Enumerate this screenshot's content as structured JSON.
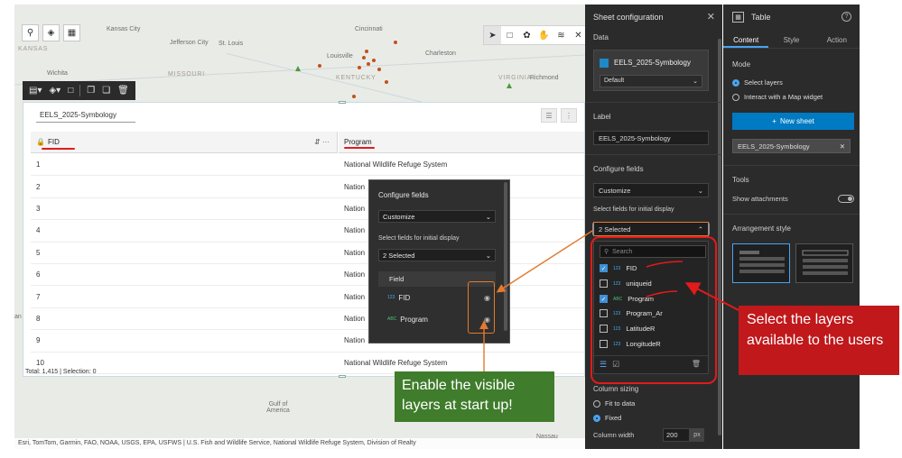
{
  "map": {
    "places": {
      "kansas_city": "Kansas City",
      "kansas": "KANSAS",
      "jefferson_city": "Jefferson City",
      "st_louis": "St. Louis",
      "missouri": "MISSOURI",
      "wichita": "Wichita",
      "cincinnati": "Cincinnati",
      "louisville": "Louisville",
      "kentucky": "KENTUCKY",
      "charleston": "Charleston",
      "virginia": "VIRGINIA",
      "richmond": "Richmond",
      "gulf_of_mexico": "Gulf of America",
      "nassau": "Nassau",
      "an": "an"
    },
    "attribution": "Esri, TomTom, Garmin, FAO, NOAA, USGS, EPA, USFWS | U.S. Fish and Wildlife Service, National Wildlife Refuge System, Division of Realty"
  },
  "table": {
    "tab_label": "EELS_2025-Symbology",
    "columns": {
      "fid": "FID",
      "program": "Program"
    },
    "rows": [
      {
        "fid": "1",
        "program": "National Wildlife Refuge System"
      },
      {
        "fid": "2",
        "program": "Nation"
      },
      {
        "fid": "3",
        "program": "Nation"
      },
      {
        "fid": "4",
        "program": "Nation"
      },
      {
        "fid": "5",
        "program": "Nation"
      },
      {
        "fid": "6",
        "program": "Nation"
      },
      {
        "fid": "7",
        "program": "Nation"
      },
      {
        "fid": "8",
        "program": "Nation"
      },
      {
        "fid": "9",
        "program": "Nation"
      },
      {
        "fid": "10",
        "program": "National Wildlife Refuge System"
      }
    ],
    "total": "Total: 1,415 | Selection: 0"
  },
  "popup": {
    "title": "Configure fields",
    "mode_value": "Customize",
    "select_label": "Select fields for initial display",
    "selected_value": "2 Selected",
    "field_header": "Field",
    "fields": [
      {
        "name": "FID",
        "type": "123"
      },
      {
        "name": "Program",
        "type": "ABC"
      }
    ]
  },
  "sheet_config": {
    "title": "Sheet configuration",
    "data_label": "Data",
    "datasource_name": "EELS_2025-Symbology",
    "view_value": "Default",
    "label_section": "Label",
    "label_value": "EELS_2025-Symbology",
    "configure_fields": "Configure fields",
    "mode_value": "Customize",
    "select_label": "Select fields for initial display",
    "selected_value": "2 Selected",
    "search_placeholder": "Search",
    "field_list": [
      {
        "name": "FID",
        "type": "123",
        "checked": true
      },
      {
        "name": "uniqueid",
        "type": "123",
        "checked": false
      },
      {
        "name": "Program",
        "type": "ABC",
        "checked": true
      },
      {
        "name": "Program_Ar",
        "type": "123",
        "checked": false
      },
      {
        "name": "LatitudeR",
        "type": "123",
        "checked": false
      },
      {
        "name": "LongitudeR",
        "type": "123",
        "checked": false
      }
    ],
    "column_sizing": "Column sizing",
    "fit_to_data": "Fit to data",
    "fixed": "Fixed",
    "column_width_label": "Column width",
    "column_width_value": "200",
    "column_width_unit": "px"
  },
  "table_panel": {
    "title": "Table",
    "tabs": [
      "Content",
      "Style",
      "Action"
    ],
    "mode_label": "Mode",
    "mode_select": "Select layers",
    "mode_interact": "Interact with a Map widget",
    "new_sheet": "New sheet",
    "sheet_chip": "EELS_2025-Symbology",
    "tools_label": "Tools",
    "show_attachments": "Show attachments",
    "arrangement_label": "Arrangement style"
  },
  "annotations": {
    "green_callout": "Enable the visible layers at start up!",
    "red_callout": "Select the layers available to the users"
  },
  "colors": {
    "accent_blue": "#007ac2",
    "panel_dark": "#2b2b2b",
    "annotation_red": "#e11b1b",
    "annotation_orange": "#e47a2e",
    "callout_green": "#3f7c2b",
    "callout_red": "#c0181b"
  }
}
